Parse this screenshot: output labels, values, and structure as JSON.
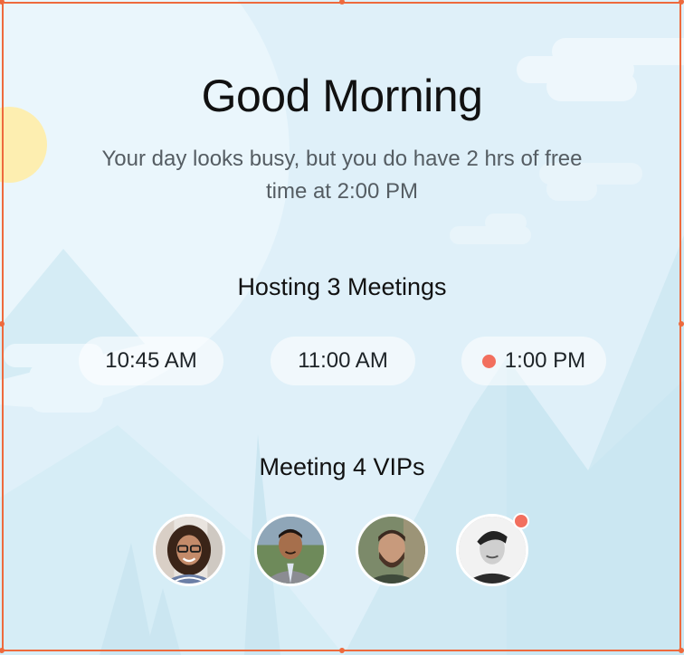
{
  "greeting": {
    "title": "Good Morning",
    "subtitle": "Your day looks busy, but you do have 2 hrs of free time at 2:00 PM"
  },
  "hosting": {
    "heading": "Hosting 3 Meetings",
    "times": [
      {
        "label": "10:45 AM",
        "highlighted": false
      },
      {
        "label": "11:00 AM",
        "highlighted": false
      },
      {
        "label": "1:00 PM",
        "highlighted": true
      }
    ]
  },
  "vips": {
    "heading": "Meeting 4 VIPs",
    "people": [
      {
        "icon": "avatar-woman-glasses",
        "has_notification": false
      },
      {
        "icon": "avatar-man-suit",
        "has_notification": false
      },
      {
        "icon": "avatar-man-beard",
        "has_notification": false
      },
      {
        "icon": "avatar-man-bw",
        "has_notification": true
      }
    ]
  },
  "colors": {
    "background": "#dff0f9",
    "accent": "#f26f5e",
    "selection": "#ee6a3d",
    "sun": "#fdeeb0",
    "text_primary": "#111111",
    "text_secondary": "#555d63"
  }
}
